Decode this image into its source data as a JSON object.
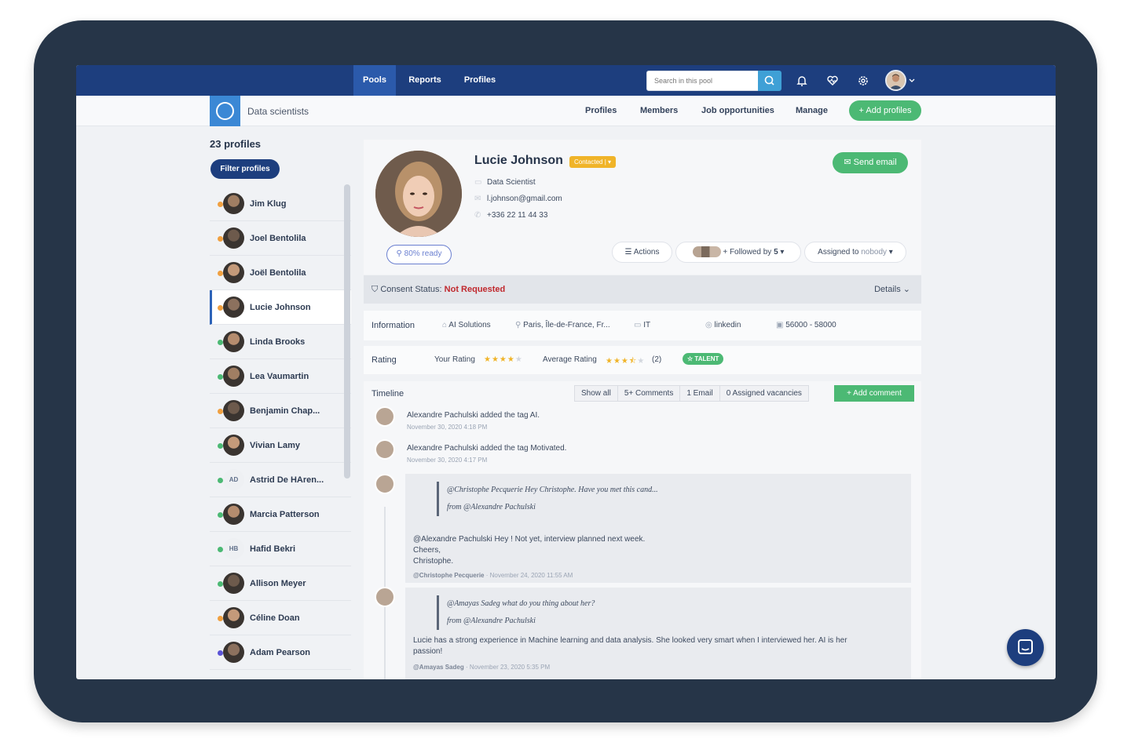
{
  "topnav": {
    "tabs": [
      {
        "label": "Pools",
        "active": true
      },
      {
        "label": "Reports",
        "active": false
      },
      {
        "label": "Profiles",
        "active": false
      }
    ],
    "search_placeholder": "Search in this pool"
  },
  "subnav": {
    "pool_name": "Data scientists",
    "tabs": [
      "Profiles",
      "Members",
      "Job opportunities",
      "Manage"
    ],
    "add_profiles_label": "+ Add profiles"
  },
  "sidebar": {
    "count_label": "23 profiles",
    "filter_label": "Filter profiles",
    "profiles": [
      {
        "name": "Jim Klug",
        "dot": "#f0a040",
        "initials": ""
      },
      {
        "name": "Joel Bentolila",
        "dot": "#f0a040",
        "initials": ""
      },
      {
        "name": "Joël Bentolila",
        "dot": "#f0a040",
        "initials": ""
      },
      {
        "name": "Lucie Johnson",
        "dot": "#f0a040",
        "initials": "",
        "active": true
      },
      {
        "name": "Linda Brooks",
        "dot": "#4cb974",
        "initials": ""
      },
      {
        "name": "Lea Vaumartin",
        "dot": "#4cb974",
        "initials": ""
      },
      {
        "name": "Benjamin Chap...",
        "dot": "#f0a040",
        "initials": ""
      },
      {
        "name": "Vivian Lamy",
        "dot": "#4cb974",
        "initials": ""
      },
      {
        "name": "Astrid De HAren...",
        "dot": "#4cb974",
        "initials": "AD"
      },
      {
        "name": "Marcia Patterson",
        "dot": "#4cb974",
        "initials": ""
      },
      {
        "name": "Hafid Bekri",
        "dot": "#4cb974",
        "initials": "HB"
      },
      {
        "name": "Allison Meyer",
        "dot": "#4cb974",
        "initials": ""
      },
      {
        "name": "Céline Doan",
        "dot": "#f0a040",
        "initials": ""
      },
      {
        "name": "Adam Pearson",
        "dot": "#5b54d6",
        "initials": ""
      }
    ]
  },
  "candidate": {
    "name": "Lucie Johnson",
    "status": "Contacted",
    "job_title": "Data Scientist",
    "email": "l.johnson@gmail.com",
    "phone": "+336 22 11 44 33",
    "ready_label": "80% ready",
    "send_email_label": "Send email",
    "actions_label": "Actions",
    "followed_label": "Followed by",
    "followed_count": "5",
    "assigned_prefix": "Assigned to",
    "assigned_value": "nobody"
  },
  "consent": {
    "label": "Consent Status:",
    "value": "Not Requested",
    "details_label": "Details"
  },
  "information": {
    "label": "Information",
    "company": "AI Solutions",
    "location": "Paris, Île-de-France, Fr...",
    "sector": "IT",
    "linkedin": "linkedin",
    "salary": "56000 - 58000"
  },
  "rating": {
    "label": "Rating",
    "your_label": "Your Rating",
    "your_value": 4,
    "avg_label": "Average Rating",
    "avg_value": 3.5,
    "avg_count": "(2)",
    "badge": "TALENT"
  },
  "timeline": {
    "label": "Timeline",
    "tabs": [
      "Show all",
      "5+ Comments",
      "1 Email",
      "0 Assigned vacancies"
    ],
    "add_comment_label": "+ Add comment",
    "events": [
      {
        "text": "Alexandre Pachulski added the tag AI.",
        "date": "November 30, 2020 4:18 PM"
      },
      {
        "text": "Alexandre Pachulski added the tag Motivated.",
        "date": "November 30, 2020 4:17 PM"
      }
    ],
    "comments": [
      {
        "quote": "@Christophe Pecquerie Hey Christophe. Have you met this cand...",
        "from": "from @Alexandre Pachulski",
        "body1": "@Alexandre Pachulski Hey ! Not yet, interview planned next week.",
        "body2": "Cheers,",
        "body3": "Christophe.",
        "author": "@Christophe Pecquerie",
        "date": "November 24, 2020 11:55 AM"
      },
      {
        "quote": "@Amayas Sadeg what do you thing about her?",
        "from": "from @Alexandre Pachulski",
        "body1": "Lucie has a strong experience in Machine learning and data analysis. She looked very smart when I interviewed her. AI is her",
        "body2": "passion!",
        "author": "@Amayas Sadeg",
        "date": "November 23, 2020 5:35 PM"
      }
    ]
  },
  "colors": {
    "navy": "#1d3e7e",
    "green": "#4cb974",
    "amber": "#f0b429",
    "danger": "#c0282d"
  }
}
